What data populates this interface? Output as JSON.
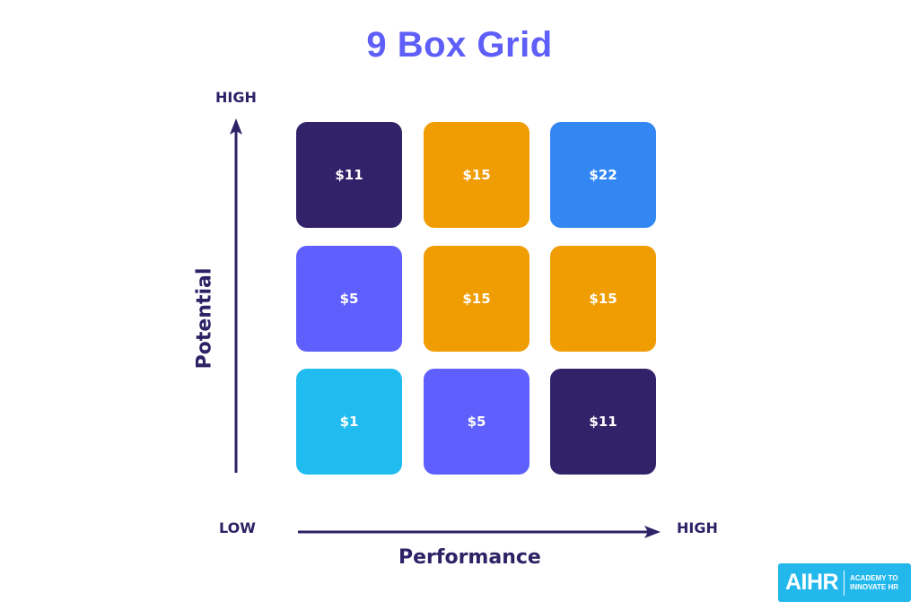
{
  "title": "9 Box Grid",
  "axes": {
    "y_title": "Potential",
    "y_high": "HIGH",
    "x_title": "Performance",
    "x_low": "LOW",
    "x_high": "HIGH"
  },
  "grid": {
    "rows": [
      [
        {
          "value": "$11",
          "color": "#32226a"
        },
        {
          "value": "$15",
          "color": "#f09c03"
        },
        {
          "value": "$22",
          "color": "#3387f2"
        }
      ],
      [
        {
          "value": "$5",
          "color": "#5f5ffe"
        },
        {
          "value": "$15",
          "color": "#f09c03"
        },
        {
          "value": "$15",
          "color": "#f09c03"
        }
      ],
      [
        {
          "value": "$1",
          "color": "#20bcf0"
        },
        {
          "value": "$5",
          "color": "#5f5ffe"
        },
        {
          "value": "$11",
          "color": "#32226a"
        }
      ]
    ]
  },
  "logo": {
    "mark": "AIHR",
    "line1": "ACADEMY TO",
    "line2": "INNOVATE HR",
    "color": "#22b8ec"
  },
  "colors": {
    "title": "#5e5ef9",
    "axis": "#2e2266"
  }
}
